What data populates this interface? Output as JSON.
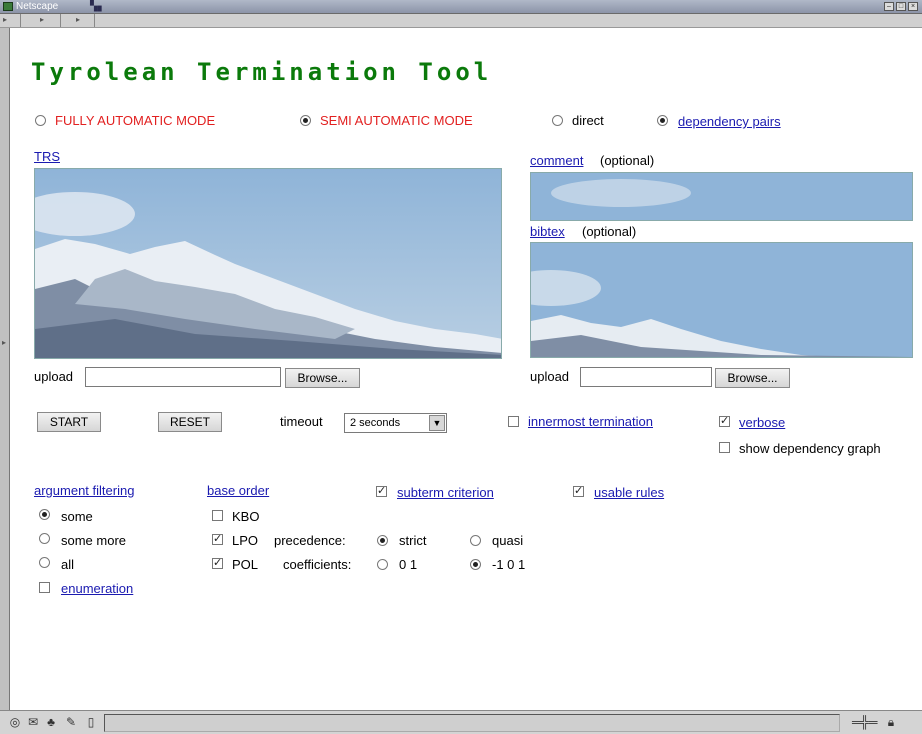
{
  "window": {
    "title": "Netscape"
  },
  "page": {
    "title": "Tyrolean Termination Tool",
    "modes": {
      "fully_automatic": {
        "label": "FULLY AUTOMATIC MODE",
        "selected": false
      },
      "semi_automatic": {
        "label": "SEMI AUTOMATIC MODE",
        "selected": true
      },
      "direct": {
        "label": "direct",
        "selected": false
      },
      "dependency_pairs": {
        "label": "dependency pairs",
        "selected": true
      }
    },
    "trs": {
      "label": "TRS"
    },
    "comment": {
      "label": "comment",
      "optional": "(optional)"
    },
    "bibtex": {
      "label": "bibtex",
      "optional": "(optional)"
    },
    "upload_left": {
      "label": "upload",
      "value": "",
      "browse_label": "Browse..."
    },
    "upload_right": {
      "label": "upload",
      "value": "",
      "browse_label": "Browse..."
    },
    "start_label": "START",
    "reset_label": "RESET",
    "timeout": {
      "label": "timeout",
      "value": "2 seconds"
    },
    "innermost": {
      "label": "innermost termination",
      "checked": false
    },
    "verbose": {
      "label": "verbose",
      "checked": true
    },
    "show_graph": {
      "label": "show dependency graph",
      "checked": false
    },
    "argument_filtering": {
      "heading": "argument filtering",
      "options": [
        {
          "label": "some",
          "selected": true
        },
        {
          "label": "some more",
          "selected": false
        },
        {
          "label": "all",
          "selected": false
        }
      ],
      "enumeration": {
        "label": "enumeration",
        "checked": false
      }
    },
    "base_order": {
      "heading": "base order",
      "kbo": {
        "label": "KBO",
        "checked": false
      },
      "lpo": {
        "label": "LPO",
        "checked": true
      },
      "pol": {
        "label": "POL",
        "checked": true
      },
      "precedence": {
        "label": "precedence:",
        "strict": "strict",
        "quasi": "quasi",
        "selected": "strict"
      },
      "coefficients": {
        "label": "coefficients:",
        "opt1": "0 1",
        "opt2": "-1 0 1",
        "selected": "-1 0 1"
      }
    },
    "subterm_criterion": {
      "label": "subterm criterion",
      "checked": true
    },
    "usable_rules": {
      "label": "usable rules",
      "checked": true
    }
  },
  "colors": {
    "title_green": "#0b7a0b",
    "mode_red": "#e22020",
    "link_blue": "#1a1ab0"
  }
}
